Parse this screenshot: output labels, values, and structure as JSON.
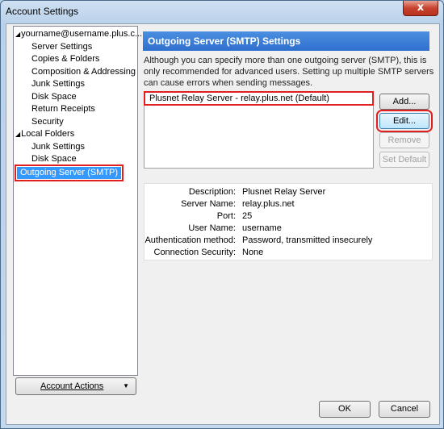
{
  "window": {
    "title": "Account Settings",
    "close_glyph": "x"
  },
  "tree": {
    "account": "yourname@username.plus.c...",
    "account_items": [
      "Server Settings",
      "Copies & Folders",
      "Composition & Addressing",
      "Junk Settings",
      "Disk Space",
      "Return Receipts",
      "Security"
    ],
    "local_folders": "Local Folders",
    "local_items": [
      "Junk Settings",
      "Disk Space"
    ],
    "selected": "Outgoing Server (SMTP)",
    "expand_glyph": "◢"
  },
  "account_actions": {
    "label": "Account Actions",
    "arrow": "▼"
  },
  "smtp": {
    "header": "Outgoing Server (SMTP) Settings",
    "description": "Although you can specify more than one outgoing server (SMTP), this is only recommended for advanced users. Setting up multiple SMTP servers can cause errors when sending messages.",
    "server_entry": "Plusnet Relay Server - relay.plus.net (Default)",
    "buttons": {
      "add": "Add...",
      "edit": "Edit...",
      "remove": "Remove",
      "set_default": "Set Default"
    },
    "details": {
      "description_label": "Description:",
      "description_value": "Plusnet Relay Server",
      "server_name_label": "Server Name:",
      "server_name_value": "relay.plus.net",
      "port_label": "Port:",
      "port_value": "25",
      "user_name_label": "User Name:",
      "user_name_value": "username",
      "auth_label": "Authentication method:",
      "auth_value": "Password, transmitted insecurely",
      "security_label": "Connection Security:",
      "security_value": "None"
    }
  },
  "dialog": {
    "ok": "OK",
    "cancel": "Cancel"
  }
}
